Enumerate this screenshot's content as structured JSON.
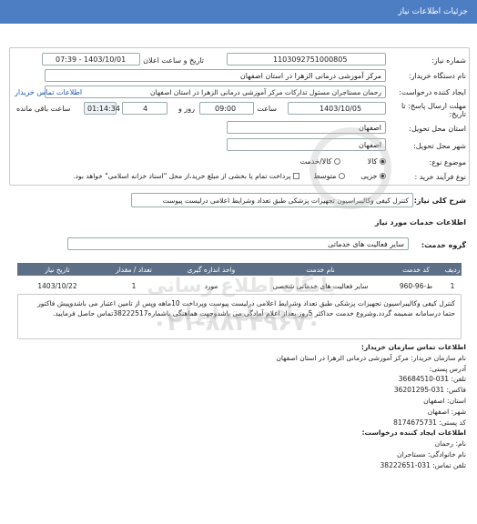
{
  "header": {
    "title": "جزئیات اطلاعات نیاز"
  },
  "form": {
    "need_number_label": "شماره نیاز:",
    "need_number": "1103092751000805",
    "announce_label": "تاریخ و ساعت اعلان عمومی:",
    "announce_value": "1403/10/01 - 07:39",
    "buyer_label": "نام دستگاه خریدار:",
    "buyer_value": "مرکز آموزشی درمانی الزهرا در استان اصفهان",
    "creator_label": "ایجاد کننده درخواست:",
    "creator_value": "رحمان مستاجران مسئول تدارکات مرکز آموزشی درمانی الزهرا در استان اصفهان",
    "buyer_contact_link": "اطلاعات تماس خریدار",
    "deadline_label": "مهلت ارسال پاسخ: تا تاریخ:",
    "deadline_date": "1403/10/05",
    "time_label": "ساعت",
    "deadline_time": "09:00",
    "days_value": "4",
    "days_label": "روز و",
    "remaining_time": "01:14:34",
    "remaining_label": "ساعت باقی مانده",
    "province_label": "استان محل تحویل:",
    "province_value": "اصفهان",
    "city_label": "شهر محل تحویل:",
    "city_value": "اصفهان",
    "category_label": "موضوع نوع:",
    "category_options": [
      "کالا",
      "کالا/خدمت"
    ],
    "process_label": "نوع فرآیند خرید :",
    "process_option": "جزیی",
    "process_option2": "متوسط",
    "process_text": "پرداخت تمام یا بخشی از مبلغ خرید،از محل \"اسناد خزانه اسلامی\" خواهد بود."
  },
  "description": {
    "label": "شرح کلی نیاز:",
    "value": "کنترل کیفی وکالیبراسیون تجهیزات پزشکی طبق تعداد وشرایط اعلامی درلیست پیوست"
  },
  "services": {
    "section_title": "اطلاعات خدمات مورد نیاز",
    "group_label": "گروه خدمت:",
    "group_value": "سایر فعالیت های خدماتی",
    "columns": [
      "ردیف",
      "کد خدمت",
      "نام خدمت",
      "واحد اندازه گیری",
      "تعداد / مقدار",
      "تاریخ نیاز"
    ],
    "rows": [
      {
        "row": "1",
        "code": "ط-96-960",
        "name": "سایر فعالیت های خدماتی شخصی",
        "unit": "مورد",
        "qty": "1",
        "date": "1403/10/22"
      }
    ]
  },
  "notes": {
    "text": "کنترل کیفی وکالیبراسیون تجهیزات پزشکی طبق تعداد وشرایط اعلامی درلیست پیوست وپرداخت 10ماهه وپس از تامین اعتبار می باشدوپیش فاکتور حتما درسامانه ضمیمه گردد.وشروع خدمت حداکثر 5روز بعداز اعلام آمادگی می باشدوجهت هماهنگی باشماره38222517تماس حاصل فرمایید."
  },
  "contact": {
    "org_title": "اطلاعات تماس سازمان خریدار:",
    "org_name": "نام سازمان خریدار: مرکز آموزشی درمانی الزهرا در استان اصفهان",
    "address": "آدرس پستی:",
    "phone": "تلفن: 031-36684510",
    "fax": "فاکس: 031-36201295",
    "city": "استان: اصفهان",
    "city2": "شهر: اصفهان",
    "postal": "کد پستی: 8174675731",
    "creator_title": "اطلاعات ایجاد کننده درخواست:",
    "first_name": "نام: رحمان",
    "last_name": "نام خانوادگی: مستاجران",
    "creator_phone": "تلفن تماس: 031-38222651"
  },
  "watermark": {
    "text1": "پایگاه اطلاع رسانی مناقصات ایران",
    "phone": "۰۲۱-۸۸۳۴۹۶۷۰"
  }
}
